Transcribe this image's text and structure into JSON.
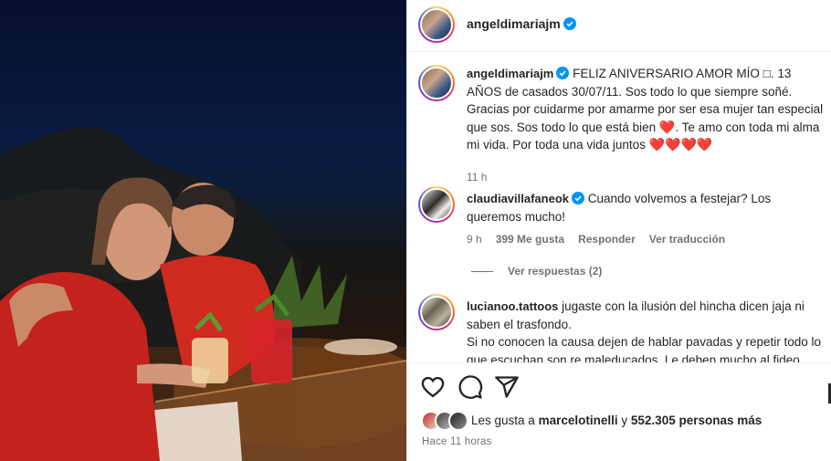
{
  "post": {
    "username": "angeldimariajm",
    "verified": true
  },
  "caption": {
    "username": "angeldimariajm",
    "text_1": "FELIZ ANIVERSARIO AMOR MÍO ",
    "box_glyph": "□",
    "text_2": ". 13 AÑOS de casados 30/07/11. Sos todo lo que siempre soñé. Gracias por cuidarme por amarme por ser esa mujer tan especial que sos. Sos todo lo que está bien ",
    "heart_1": "❤️",
    "text_3": ". Te amo con toda mi alma mi vida. Por toda una vida juntos ",
    "hearts_end": "❤️❤️❤️❤️",
    "time": "11 h"
  },
  "comments": [
    {
      "username": "claudiavillafaneok",
      "verified": true,
      "text": "Cuando volvemos a festejar? Los queremos mucho!",
      "time": "9 h",
      "likes": "399 Me gusta",
      "reply": "Responder",
      "translate": "Ver traducción",
      "view_replies": "Ver respuestas (2)"
    },
    {
      "username": "lucianoo.tattoos",
      "verified": false,
      "text_1": "jugaste con la ilusión del hincha dicen jaja ni saben el trasfondo.",
      "text_2": "Si no conocen la causa dejen de hablar pavadas y repetir todo lo que escuchan son re maleducados. Le deben mucho al fideo"
    }
  ],
  "likes": {
    "prefix": "Les gusta a",
    "user": "marcelotinelli",
    "joiner": "y",
    "others": "552.305 personas más"
  },
  "posted_ago": "Hace 11 horas",
  "icons": [
    "heart-outline-icon",
    "comment-icon",
    "share-icon",
    "verified-badge-icon"
  ],
  "colors": {
    "verified": "#0095f6",
    "heart": "#e0182d",
    "secondary_text": "#737373"
  }
}
